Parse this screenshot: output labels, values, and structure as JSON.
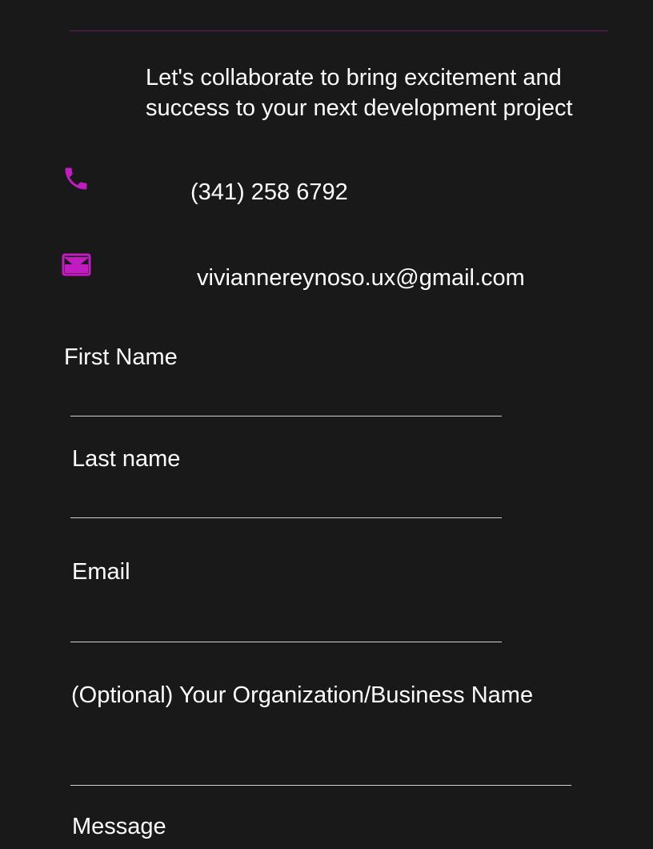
{
  "contact": {
    "tagline": "Let's collaborate to bring excitement and success to your next development project",
    "phone_icon": "phone-icon",
    "phone": "(341) 258 6792",
    "email_icon": "mail-icon",
    "email": "viviannereynoso.ux@gmail.com"
  },
  "form": {
    "first_name_label": "First Name",
    "first_name_value": "",
    "last_name_label": "Last name",
    "last_name_value": "",
    "email_label": "Email",
    "email_value": "",
    "organization_label": "(Optional) Your Organization/Business Name",
    "organization_value": "",
    "message_label": "Message"
  },
  "colors": {
    "background": "#191919",
    "accent": "#c11bc1",
    "divider": "#6a1a6a",
    "text": "#ffffff",
    "underline": "#d0d0d0"
  }
}
